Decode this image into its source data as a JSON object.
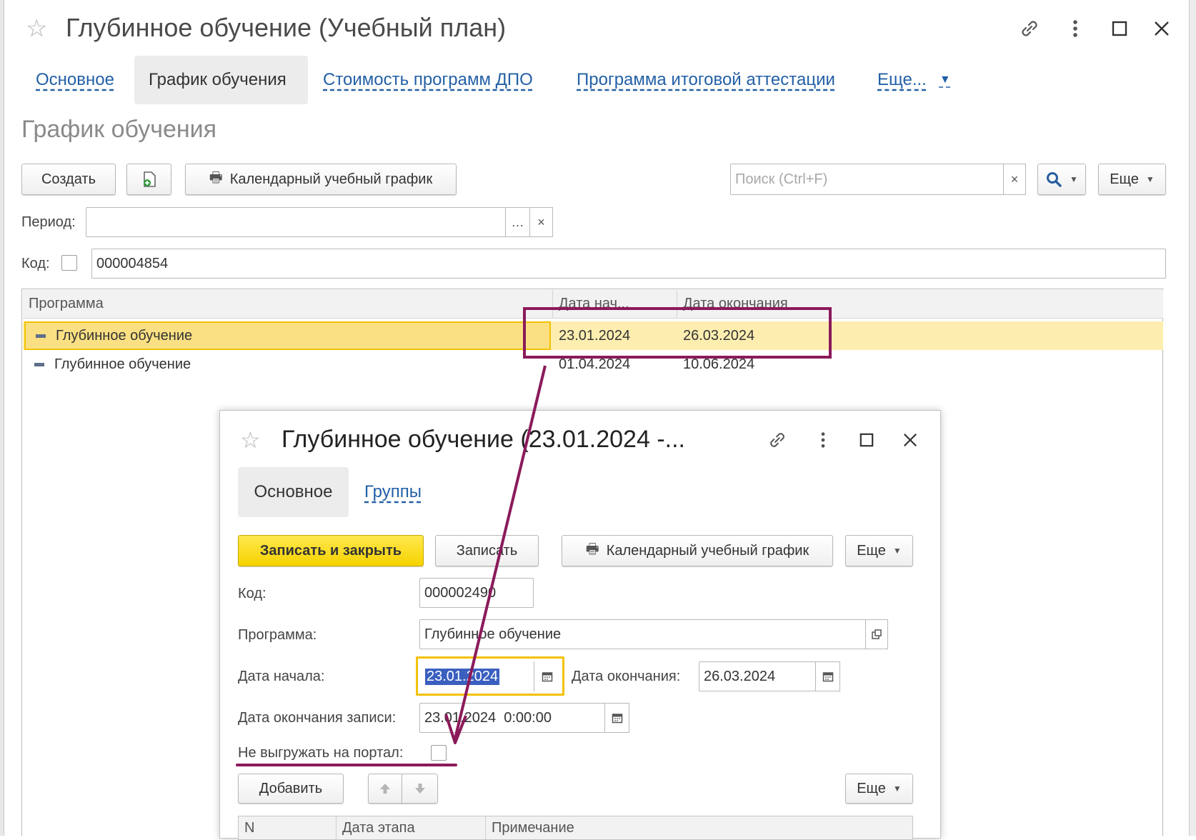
{
  "window": {
    "title": "Глубинное обучение (Учебный план)"
  },
  "tabs": [
    {
      "label": "Основное"
    },
    {
      "label": "График обучения"
    },
    {
      "label": "Стоимость программ ДПО"
    },
    {
      "label": "Программа итоговой аттестации"
    },
    {
      "label": "Еще..."
    }
  ],
  "section": {
    "title": "График обучения"
  },
  "toolbar": {
    "create_label": "Создать",
    "calendar_label": "Календарный учебный график",
    "search_placeholder": "Поиск (Ctrl+F)",
    "more_label": "Еще"
  },
  "filters": {
    "period_label": "Период:",
    "period_value": "",
    "code_label": "Код:",
    "code_value": "000004854"
  },
  "table": {
    "columns": [
      "Программа",
      "Дата нач...",
      "Дата окончания"
    ],
    "rows": [
      {
        "program": "Глубинное обучение",
        "start": "23.01.2024",
        "end": "26.03.2024"
      },
      {
        "program": "Глубинное обучение",
        "start": "01.04.2024",
        "end": "10.06.2024"
      }
    ]
  },
  "dialog": {
    "title": "Глубинное обучение (23.01.2024 -...",
    "tabs": [
      {
        "label": "Основное"
      },
      {
        "label": "Группы"
      }
    ],
    "toolbar": {
      "save_close_label": "Записать и закрыть",
      "save_label": "Записать",
      "calendar_label": "Календарный учебный график",
      "more_label": "Еще"
    },
    "fields": {
      "code_label": "Код:",
      "code_value": "000002490",
      "program_label": "Программа:",
      "program_value": "Глубинное обучение",
      "start_label": "Дата начала:",
      "start_value": "23.01.2024",
      "end_label": "Дата окончания:",
      "end_value": "26.03.2024",
      "enroll_end_label": "Дата окончания записи:",
      "enroll_end_value": "23.01.2024  0:00:00",
      "no_export_label": "Не выгружать на портал:"
    },
    "stages_toolbar": {
      "add_label": "Добавить",
      "more_label": "Еще"
    },
    "stages_table": {
      "columns": [
        "N",
        "Дата этапа",
        "Примечание"
      ]
    }
  },
  "colors": {
    "link": "#2360a6",
    "selected_row": "#fdeeb0",
    "primary_button": "#f5d200",
    "annotation": "#8b1a5a",
    "focus": "#f2c200"
  }
}
